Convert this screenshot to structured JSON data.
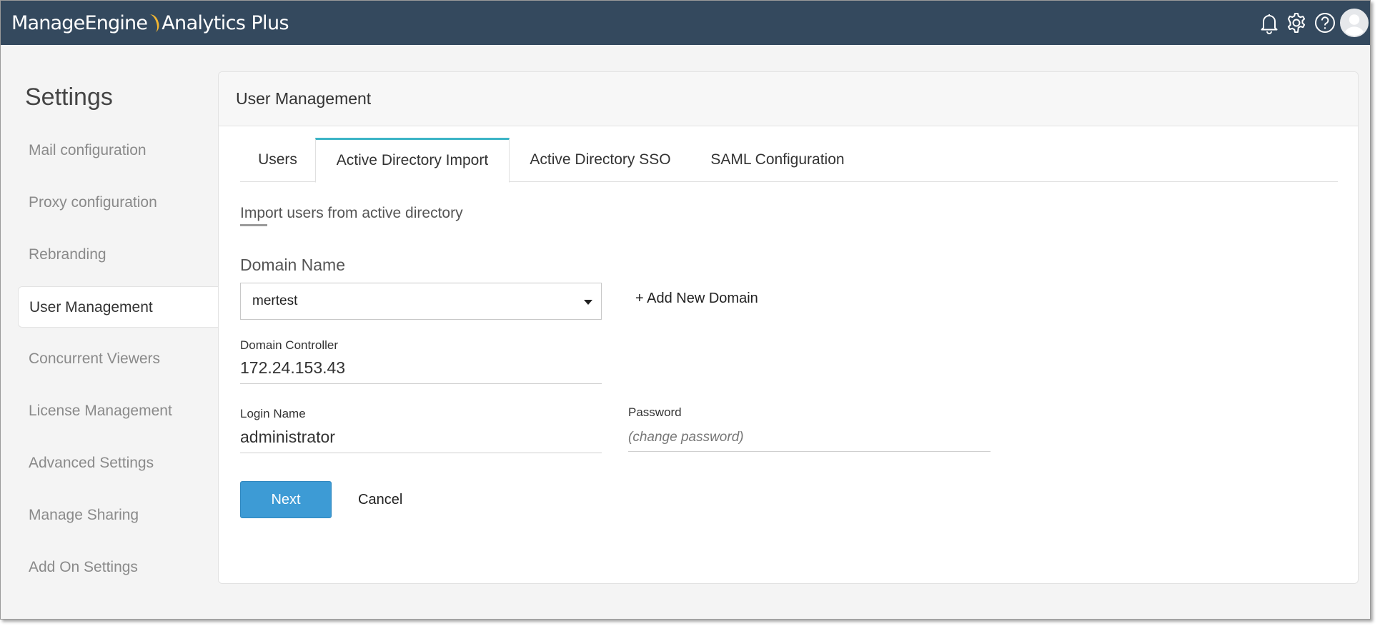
{
  "app": {
    "brand_left": "ManageEngine",
    "brand_right": "Analytics Plus"
  },
  "top_icons": [
    "bell-icon",
    "gear-icon",
    "help-icon",
    "avatar"
  ],
  "sidebar": {
    "title": "Settings",
    "items": [
      {
        "label": "Mail configuration",
        "active": false
      },
      {
        "label": "Proxy configuration",
        "active": false
      },
      {
        "label": "Rebranding",
        "active": false
      },
      {
        "label": "User Management",
        "active": true
      },
      {
        "label": "Concurrent Viewers",
        "active": false
      },
      {
        "label": "License Management",
        "active": false
      },
      {
        "label": "Advanced Settings",
        "active": false
      },
      {
        "label": "Manage Sharing",
        "active": false
      },
      {
        "label": "Add On Settings",
        "active": false
      }
    ]
  },
  "panel": {
    "title": "User Management",
    "tabs": [
      {
        "label": "Users",
        "active": false
      },
      {
        "label": "Active Directory Import",
        "active": true
      },
      {
        "label": "Active Directory SSO",
        "active": false
      },
      {
        "label": "SAML Configuration",
        "active": false
      }
    ],
    "section_title": "Import users from active directory",
    "form": {
      "domain_name_label": "Domain Name",
      "domain_name_value": "mertest",
      "add_domain": "+ Add New Domain",
      "controller_label": "Domain Controller",
      "controller_value": "172.24.153.43",
      "login_label": "Login Name",
      "login_value": "administrator",
      "password_label": "Password",
      "password_placeholder": "(change password)"
    },
    "buttons": {
      "next": "Next",
      "cancel": "Cancel"
    }
  },
  "colors": {
    "topbar": "#34495e",
    "accent_tab": "#3cb4c6",
    "primary_button": "#3d9bd5",
    "logo_arc": "#f2b632"
  }
}
